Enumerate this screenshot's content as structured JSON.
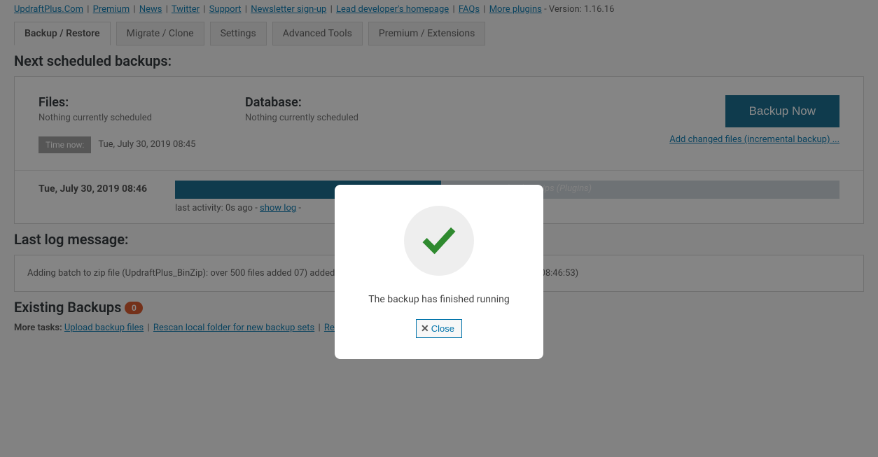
{
  "top_links": {
    "updraft": "UpdraftPlus.Com",
    "premium": "Premium",
    "news": "News",
    "twitter": "Twitter",
    "support": "Support",
    "newsletter": "Newsletter sign-up",
    "lead_dev": "Lead developer's homepage",
    "faqs": "FAQs",
    "more_plugins": "More plugins",
    "version_label": " - Version: 1.16.16"
  },
  "tabs": {
    "backup_restore": "Backup / Restore",
    "migrate_clone": "Migrate / Clone",
    "settings": "Settings",
    "advanced_tools": "Advanced Tools",
    "premium_ext": "Premium / Extensions"
  },
  "section_titles": {
    "next_scheduled": "Next scheduled backups:",
    "last_log": "Last log message:",
    "existing": "Existing Backups"
  },
  "scheduled": {
    "files_label": "Files:",
    "files_value": "Nothing currently scheduled",
    "db_label": "Database:",
    "db_value": "Nothing currently scheduled",
    "time_now_label": "Time now:",
    "time_now_value": "Tue, July 30, 2019 08:45",
    "backup_now_btn": "Backup Now",
    "incremental_link": "Add changed files (incremental backup) ..."
  },
  "progress": {
    "timestamp": "Tue, July 30, 2019 08:46",
    "bar_text": "backup zips (Plugins)",
    "meta_prefix": "last activity: 0s ago - ",
    "show_log": "show log",
    "meta_dash": " - "
  },
  "log_message": "Adding batch to zip file (UpdraftPlus_BinZip): over 500 files added                                                                                 07) added so far): re-opening (prior size: 12955.2 KB) (Jul 30 08:46:53)",
  "existing_count": "0",
  "more_tasks": {
    "label": "More tasks:",
    "upload": "Upload backup files",
    "rescan_local": "Rescan local folder for new backup sets",
    "rescan_remote": "Rescan remote storage"
  },
  "dialog": {
    "message": "The backup has finished running",
    "close": "Close"
  }
}
